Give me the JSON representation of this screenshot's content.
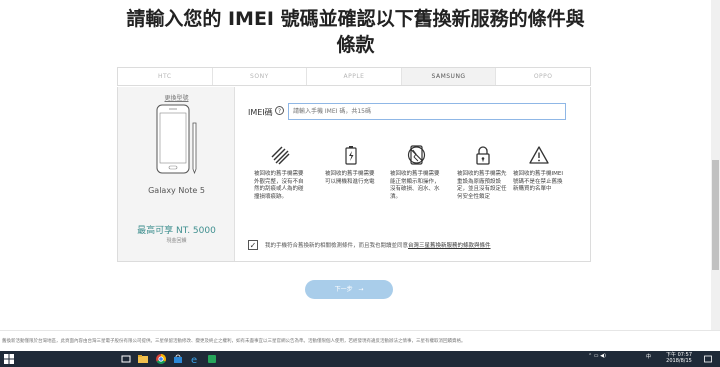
{
  "heading": {
    "line1": "請輸入您的 IMEI 號碼並確認以下舊換新服務的條件與",
    "line2": "條款"
  },
  "tabs": [
    {
      "label": "HTC",
      "active": false
    },
    {
      "label": "SONY",
      "active": false
    },
    {
      "label": "APPLE",
      "active": false
    },
    {
      "label": "SAMSUNG",
      "active": true
    },
    {
      "label": "OPPO",
      "active": false
    }
  ],
  "device": {
    "change_model_link": "更換型號",
    "model_name": "Galaxy Note 5",
    "price": "最高可享 NT. 5000",
    "price_note": "現金回饋"
  },
  "imei": {
    "label": "IMEI碼",
    "help": "?",
    "placeholder": "請輸入手機 IMEI 碼，共15碼"
  },
  "conditions": [
    {
      "icon": "scratch-lines-icon",
      "text": "被回收的舊手機需要外觀完整，沒有不自然的刮痕或人為的碰撞損壞痕跡。"
    },
    {
      "icon": "battery-charge-icon",
      "text": "被回收的舊手機需要可以開機和進行充電"
    },
    {
      "icon": "broken-phone-icon",
      "text": "被回收的舊手機需要能正常顯示和操作，沒有破損、泡水、水漬。"
    },
    {
      "icon": "lock-icon",
      "text": "被回收的舊手機需先重設為原廠預設設定，並且沒有設定任何安全性鎖定"
    },
    {
      "icon": "warning-icon",
      "text": "被回收的舊手機IMEI號碼不是在禁止舊換新購買的名單中"
    }
  ],
  "agreement": {
    "checked": true,
    "check_mark": "✓",
    "text": "我的手機符合舊換新的相關檢測條件，而且我也閱讀並同意",
    "link": "台灣三星舊換新服務的條款與條件"
  },
  "next_button": {
    "label": "下一步",
    "arrow": "→"
  },
  "bottom_note": "舊換新活動僅限於台灣地區，此頁面內容由台灣三星電子股份有限公司提供。三星保留活動修改、變更及終止之權利，如有未盡事宜以三星官網公告為準。活動僅限個人使用，若經發現有違反活動辦法之情事，三星有權取消回饋資格。",
  "taskbar": {
    "time": "下午 07:57",
    "date": "2018/8/15",
    "lang": "中"
  }
}
